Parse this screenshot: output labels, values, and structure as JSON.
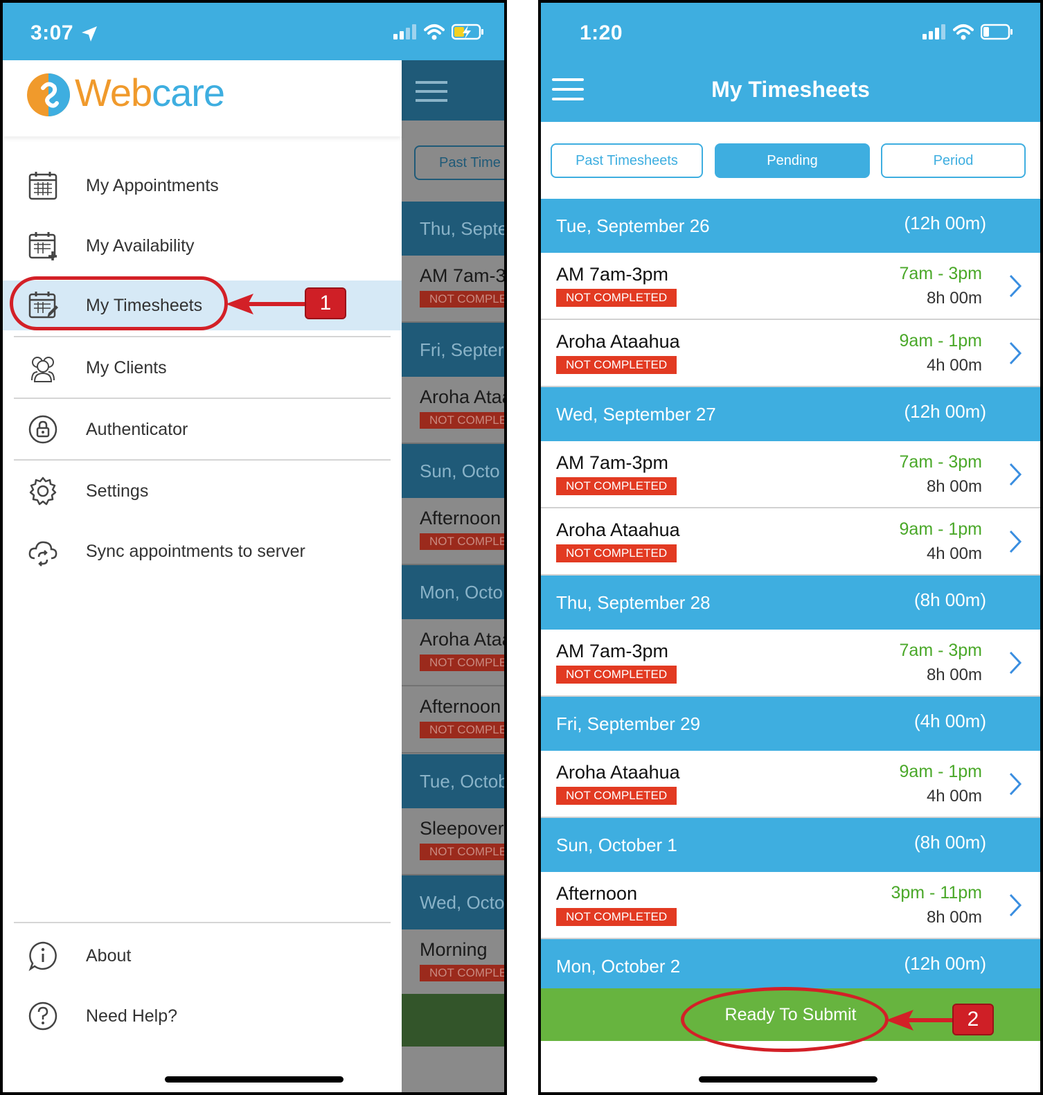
{
  "left": {
    "status_time": "3:07",
    "logo": {
      "brand_part1": "Web",
      "brand_part2": "care"
    },
    "menu": [
      {
        "label": "My Appointments",
        "icon": "calendar-icon"
      },
      {
        "label": "My Availability",
        "icon": "calendar-plus-icon"
      },
      {
        "label": "My Timesheets",
        "icon": "calendar-edit-icon"
      },
      {
        "label": "My Clients",
        "icon": "users-icon"
      },
      {
        "label": "Authenticator",
        "icon": "lock-icon"
      },
      {
        "label": "Settings",
        "icon": "gear-icon"
      },
      {
        "label": "Sync appointments to server",
        "icon": "cloud-sync-icon"
      }
    ],
    "footer_menu": [
      {
        "label": "About",
        "icon": "info-icon"
      },
      {
        "label": "Need Help?",
        "icon": "help-icon"
      }
    ],
    "callout_number": "1",
    "background": {
      "tab": "Past Time",
      "days": [
        "Thu, Septe",
        "Fri, Septer",
        "Sun, Octo",
        "Mon, Octo",
        "Tue, Octob",
        "Wed, Octo"
      ],
      "items": [
        "AM 7am-3",
        "Aroha Ataa",
        "Afternoon",
        "Aroha Ataa",
        "Afternoon",
        "Sleepover",
        "Morning"
      ],
      "badge": "NOT COMPLE"
    }
  },
  "right": {
    "status_time": "1:20",
    "title": "My Timesheets",
    "tabs": {
      "past": "Past Timesheets",
      "pending": "Pending",
      "period": "Period"
    },
    "days": [
      {
        "name": "Tue, September 26",
        "total": "(12h 00m)",
        "items": [
          {
            "title": "AM 7am-3pm",
            "status": "NOT COMPLETED",
            "time": "7am - 3pm",
            "duration": "8h 00m"
          },
          {
            "title": "Aroha Ataahua",
            "status": "NOT COMPLETED",
            "time": "9am - 1pm",
            "duration": "4h 00m"
          }
        ]
      },
      {
        "name": "Wed, September 27",
        "total": "(12h 00m)",
        "items": [
          {
            "title": "AM 7am-3pm",
            "status": "NOT COMPLETED",
            "time": "7am - 3pm",
            "duration": "8h 00m"
          },
          {
            "title": "Aroha Ataahua",
            "status": "NOT COMPLETED",
            "time": "9am - 1pm",
            "duration": "4h 00m"
          }
        ]
      },
      {
        "name": "Thu, September 28",
        "total": "(8h 00m)",
        "items": [
          {
            "title": "AM 7am-3pm",
            "status": "NOT COMPLETED",
            "time": "7am - 3pm",
            "duration": "8h 00m"
          }
        ]
      },
      {
        "name": "Fri, September 29",
        "total": "(4h 00m)",
        "items": [
          {
            "title": "Aroha Ataahua",
            "status": "NOT COMPLETED",
            "time": "9am - 1pm",
            "duration": "4h 00m"
          }
        ]
      },
      {
        "name": "Sun, October 1",
        "total": "(8h 00m)",
        "items": [
          {
            "title": "Afternoon",
            "status": "NOT COMPLETED",
            "time": "3pm - 11pm",
            "duration": "8h 00m"
          }
        ]
      },
      {
        "name": "Mon, October 2",
        "total": "(12h 00m)",
        "items": []
      }
    ],
    "submit_label": "Ready To Submit",
    "callout_number": "2"
  },
  "colors": {
    "brand_blue": "#3eaee0",
    "brand_orange": "#f09a2c",
    "status_red": "#e23a22",
    "time_green": "#4aa829",
    "submit_green": "#67b43f",
    "annotation_red": "#d32027"
  }
}
